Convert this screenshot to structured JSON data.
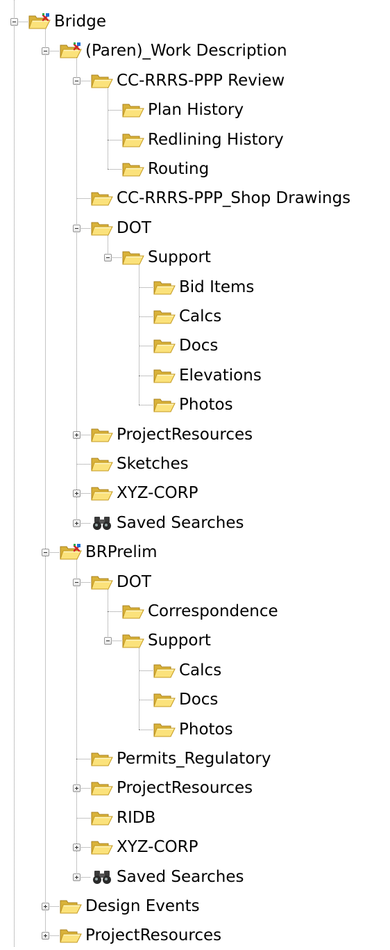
{
  "tree": [
    {
      "label": "Bridge",
      "icon": "project-folder-icon",
      "depth": 0,
      "expander": "minus"
    },
    {
      "label": "(Paren)_Work Description",
      "icon": "project-folder-icon",
      "depth": 1,
      "expander": "minus"
    },
    {
      "label": "CC-RRRS-PPP Review",
      "icon": "folder-icon",
      "depth": 2,
      "expander": "minus"
    },
    {
      "label": "Plan History",
      "icon": "folder-icon",
      "depth": 3,
      "expander": "none"
    },
    {
      "label": "Redlining History",
      "icon": "folder-icon",
      "depth": 3,
      "expander": "none"
    },
    {
      "label": "Routing",
      "icon": "folder-icon",
      "depth": 3,
      "expander": "none"
    },
    {
      "label": "CC-RRRS-PPP_Shop Drawings",
      "icon": "folder-icon",
      "depth": 2,
      "expander": "none"
    },
    {
      "label": "DOT",
      "icon": "folder-icon",
      "depth": 2,
      "expander": "minus"
    },
    {
      "label": "Support",
      "icon": "folder-icon",
      "depth": 3,
      "expander": "minus"
    },
    {
      "label": "Bid Items",
      "icon": "folder-icon",
      "depth": 4,
      "expander": "none"
    },
    {
      "label": "Calcs",
      "icon": "folder-icon",
      "depth": 4,
      "expander": "none"
    },
    {
      "label": "Docs",
      "icon": "folder-icon",
      "depth": 4,
      "expander": "none"
    },
    {
      "label": "Elevations",
      "icon": "folder-icon",
      "depth": 4,
      "expander": "none"
    },
    {
      "label": "Photos",
      "icon": "folder-icon",
      "depth": 4,
      "expander": "none"
    },
    {
      "label": "ProjectResources",
      "icon": "folder-icon",
      "depth": 2,
      "expander": "plus"
    },
    {
      "label": "Sketches",
      "icon": "folder-icon",
      "depth": 2,
      "expander": "none"
    },
    {
      "label": "XYZ-CORP",
      "icon": "folder-icon",
      "depth": 2,
      "expander": "plus"
    },
    {
      "label": "Saved Searches",
      "icon": "binoculars-icon",
      "depth": 2,
      "expander": "plus"
    },
    {
      "label": "BRPrelim",
      "icon": "project-folder-icon",
      "depth": 1,
      "expander": "minus"
    },
    {
      "label": "DOT",
      "icon": "folder-icon",
      "depth": 2,
      "expander": "minus"
    },
    {
      "label": "Correspondence",
      "icon": "folder-icon",
      "depth": 3,
      "expander": "none"
    },
    {
      "label": "Support",
      "icon": "folder-icon",
      "depth": 3,
      "expander": "minus"
    },
    {
      "label": "Calcs",
      "icon": "folder-icon",
      "depth": 4,
      "expander": "none"
    },
    {
      "label": "Docs",
      "icon": "folder-icon",
      "depth": 4,
      "expander": "none"
    },
    {
      "label": "Photos",
      "icon": "folder-icon",
      "depth": 4,
      "expander": "none"
    },
    {
      "label": "Permits_Regulatory",
      "icon": "folder-icon",
      "depth": 2,
      "expander": "none"
    },
    {
      "label": "ProjectResources",
      "icon": "folder-icon",
      "depth": 2,
      "expander": "plus"
    },
    {
      "label": "RIDB",
      "icon": "folder-icon",
      "depth": 2,
      "expander": "none"
    },
    {
      "label": "XYZ-CORP",
      "icon": "folder-icon",
      "depth": 2,
      "expander": "plus"
    },
    {
      "label": "Saved Searches",
      "icon": "binoculars-icon",
      "depth": 2,
      "expander": "plus"
    },
    {
      "label": "Design Events",
      "icon": "folder-icon",
      "depth": 1,
      "expander": "plus"
    },
    {
      "label": "ProjectResources",
      "icon": "folder-icon",
      "depth": 1,
      "expander": "plus"
    }
  ]
}
